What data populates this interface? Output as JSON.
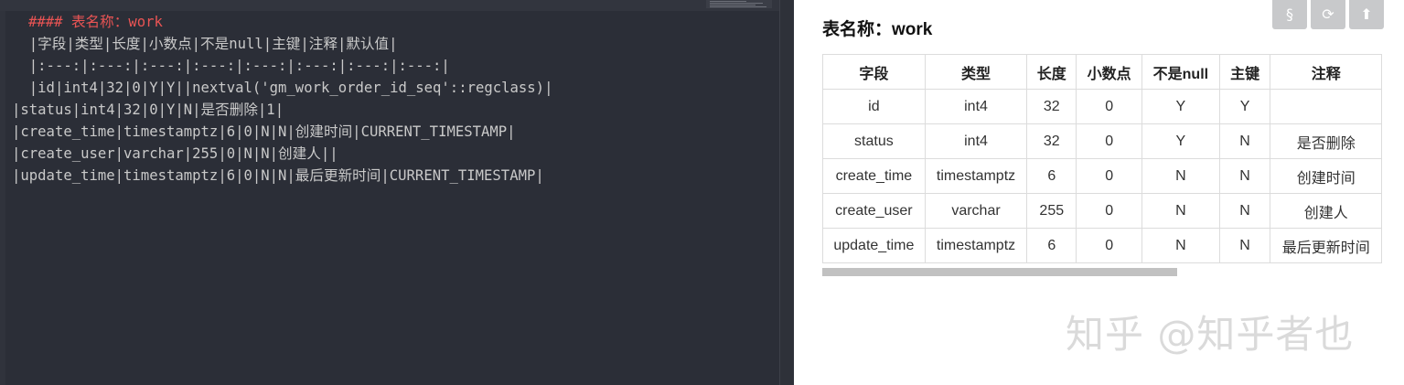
{
  "editor": {
    "lines": [
      "#### 表名称：work",
      "  |字段|类型|长度|小数点|不是null|主键|注释|默认值|",
      "  |:---:|:---:|:---:|:---:|:---:|:---:|:---:|:---:|",
      "  |id|int4|32|0|Y|Y||nextval('gm_work_order_id_seq'::regclass)|",
      "|status|int4|32|0|Y|N|是否删除|1|",
      "|create_time|timestamptz|6|0|N|N|创建时间|CURRENT_TIMESTAMP|",
      "|create_user|varchar|255|0|N|N|创建人||",
      "|update_time|timestamptz|6|0|N|N|最后更新时间|CURRENT_TIMESTAMP|"
    ]
  },
  "preview": {
    "title": "表名称：work",
    "toolbar": [
      {
        "icon": "section-icon",
        "glyph": "§"
      },
      {
        "icon": "refresh-icon",
        "glyph": "⟳"
      },
      {
        "icon": "upload-icon",
        "glyph": "⬆"
      }
    ],
    "table": {
      "headers": [
        "字段",
        "类型",
        "长度",
        "小数点",
        "不是null",
        "主键",
        "注释"
      ],
      "rows": [
        [
          "id",
          "int4",
          "32",
          "0",
          "Y",
          "Y",
          ""
        ],
        [
          "status",
          "int4",
          "32",
          "0",
          "Y",
          "N",
          "是否删除"
        ],
        [
          "create_time",
          "timestamptz",
          "6",
          "0",
          "N",
          "N",
          "创建时间"
        ],
        [
          "create_user",
          "varchar",
          "255",
          "0",
          "N",
          "N",
          "创建人"
        ],
        [
          "update_time",
          "timestamptz",
          "6",
          "0",
          "N",
          "N",
          "最后更新时间"
        ]
      ]
    },
    "watermark": "知乎 @知乎者也"
  },
  "colors": {
    "editor_bg": "#2b2e37",
    "heading": "#ea5454",
    "code_text": "#c9c9c9"
  }
}
